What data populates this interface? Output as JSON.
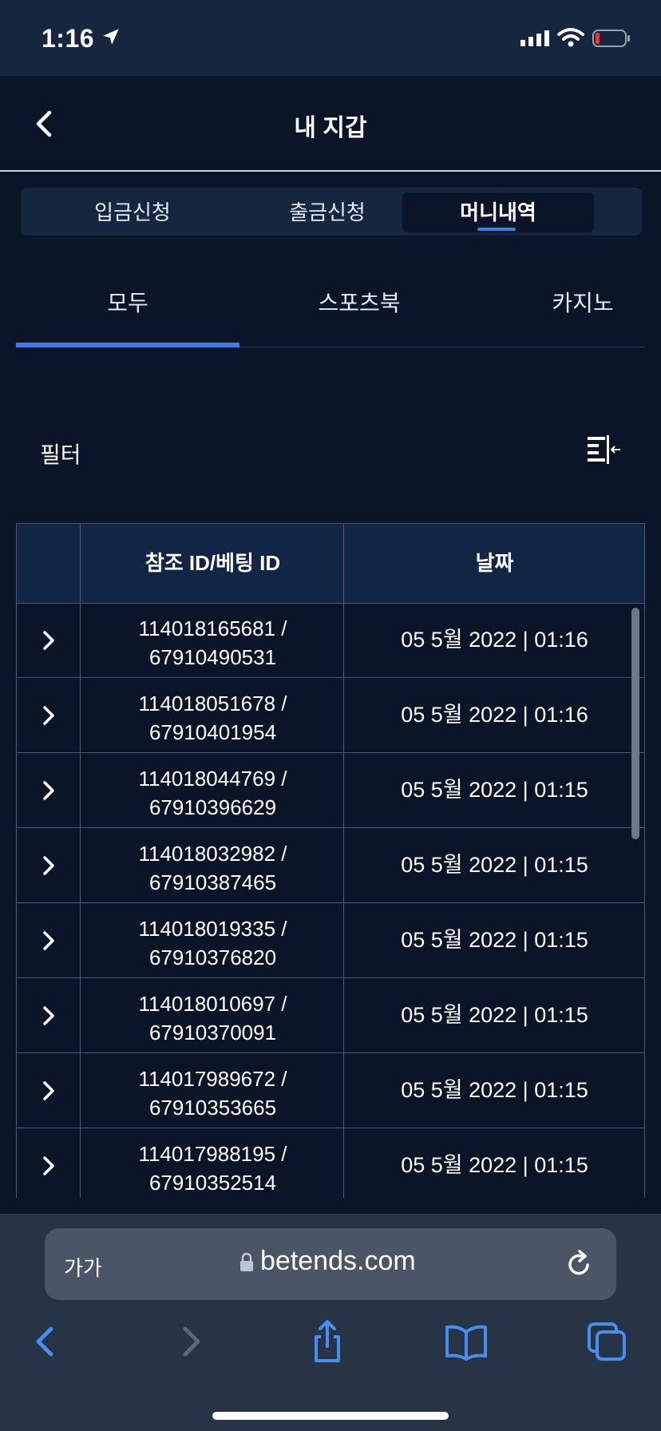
{
  "status": {
    "time": "1:16"
  },
  "header": {
    "title": "내 지갑"
  },
  "wallet_tabs": [
    {
      "label": "입금신청"
    },
    {
      "label": "출금신청"
    },
    {
      "label": "머니내역"
    }
  ],
  "sub_tabs": [
    {
      "label": "모두"
    },
    {
      "label": "스포츠북"
    },
    {
      "label": "카지노"
    }
  ],
  "filter": {
    "label": "필터"
  },
  "table": {
    "headers": [
      "참조 ID/베팅 ID",
      "날짜"
    ],
    "rows": [
      {
        "ref_id": "114018165681 /",
        "bet_id": "67910490531",
        "date": "05 5월 2022 | 01:16"
      },
      {
        "ref_id": "114018051678 /",
        "bet_id": "67910401954",
        "date": "05 5월 2022 | 01:16"
      },
      {
        "ref_id": "114018044769 /",
        "bet_id": "67910396629",
        "date": "05 5월 2022 | 01:15"
      },
      {
        "ref_id": "114018032982 /",
        "bet_id": "67910387465",
        "date": "05 5월 2022 | 01:15"
      },
      {
        "ref_id": "114018019335 /",
        "bet_id": "67910376820",
        "date": "05 5월 2022 | 01:15"
      },
      {
        "ref_id": "114018010697 /",
        "bet_id": "67910370091",
        "date": "05 5월 2022 | 01:15"
      },
      {
        "ref_id": "114017989672 /",
        "bet_id": "67910353665",
        "date": "05 5월 2022 | 01:15"
      },
      {
        "ref_id": "114017988195 /",
        "bet_id": "67910352514",
        "date": "05 5월 2022 | 01:15"
      }
    ]
  },
  "browser": {
    "text_size": "가가",
    "domain": "betends.com"
  },
  "colors": {
    "background": "#0a1628",
    "accent": "#3d7de8",
    "header_row": "#112544",
    "browser_bar": "#263446"
  },
  "icons": [
    "location-arrow-icon",
    "signal-icon",
    "wifi-icon",
    "battery-icon",
    "back-chevron-icon",
    "filter-icon",
    "chevron-right-icon",
    "lock-icon",
    "reload-icon",
    "safari-back-icon",
    "safari-forward-icon",
    "share-icon",
    "bookmarks-icon",
    "tabs-icon"
  ]
}
